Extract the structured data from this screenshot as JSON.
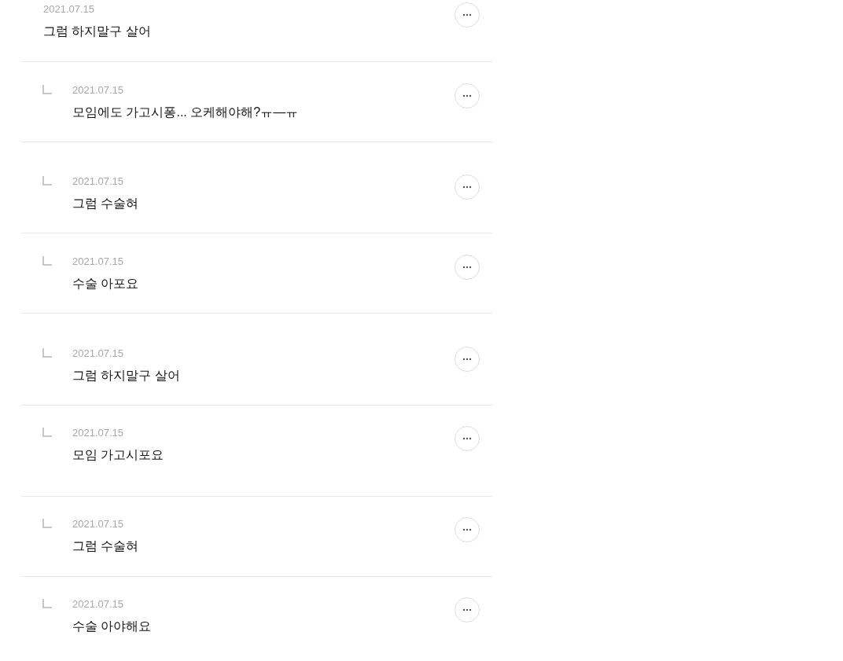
{
  "comments": [
    {
      "kind": "comment",
      "date": "2021.07.15",
      "text": "그럼 하지말구 살어"
    },
    {
      "kind": "reply",
      "date": "2021.07.15",
      "text": "모임에도 가고시퐁... 오케해야해?ㅠ—ㅠ"
    },
    {
      "kind": "reply",
      "date": "2021.07.15",
      "text": "그럼 수술혀"
    },
    {
      "kind": "reply",
      "date": "2021.07.15",
      "text": "수술 아포요"
    },
    {
      "kind": "reply",
      "date": "2021.07.15",
      "text": "그럼 하지말구 살어"
    },
    {
      "kind": "reply",
      "date": "2021.07.15",
      "text": "모임 가고시포요"
    },
    {
      "kind": "reply",
      "date": "2021.07.15",
      "text": "그럼 수술혀"
    },
    {
      "kind": "reply",
      "date": "2021.07.15",
      "text": "수술 아야해요"
    }
  ]
}
